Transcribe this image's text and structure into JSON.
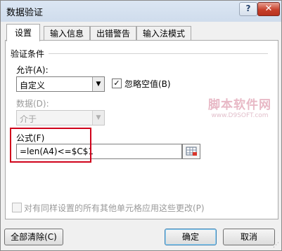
{
  "window": {
    "title": "数据验证",
    "help_glyph": "?",
    "close_glyph": "✕"
  },
  "tabs": [
    {
      "label": "设置",
      "active": true
    },
    {
      "label": "输入信息",
      "active": false
    },
    {
      "label": "出错警告",
      "active": false
    },
    {
      "label": "输入法模式",
      "active": false
    }
  ],
  "validation": {
    "section_label": "验证条件",
    "allow_label": "允许(A):",
    "allow_value": "自定义",
    "ignore_blank_label": "忽略空值(B)",
    "ignore_blank_checked": true,
    "data_label": "数据(D):",
    "data_value": "介于",
    "formula_label": "公式(F)",
    "formula_value": "=len(A4)<=$C$1",
    "apply_all_label": "对有同样设置的所有其他单元格应用这些更改(P)",
    "apply_all_checked": false
  },
  "watermark": {
    "line1": "脚本软件网",
    "line2": "www.D9SOFT.com"
  },
  "buttons": {
    "clear_all": "全部清除(C)",
    "ok": "确定",
    "cancel": "取消"
  },
  "icons": {
    "dropdown": "▼",
    "check": "✓",
    "range_select": "range-select-icon"
  },
  "colors": {
    "highlight": "#d0021b",
    "titlebar": "#dbe6f3",
    "close_button": "#c7402b"
  }
}
